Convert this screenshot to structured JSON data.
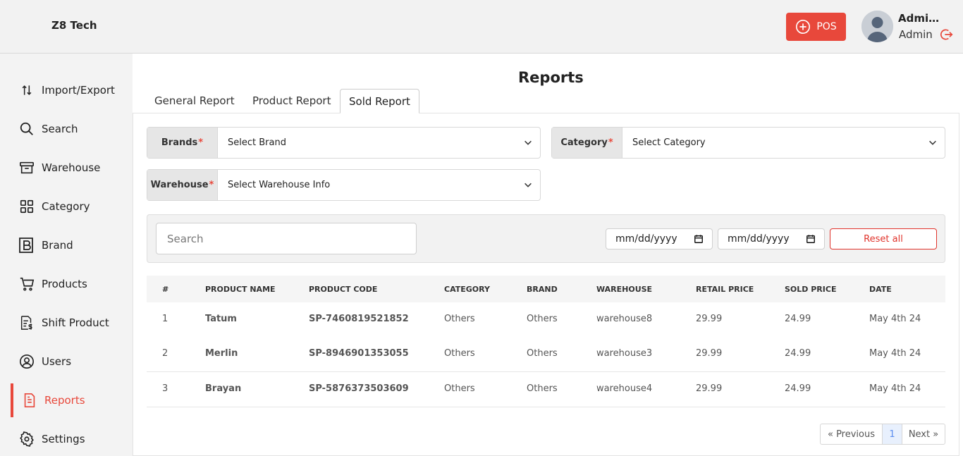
{
  "header": {
    "brand": "Z8 Tech",
    "pos_label": "POS",
    "user_name": "Admin...",
    "user_role": "Admin"
  },
  "sidebar": {
    "items": [
      {
        "label": "Import/Export",
        "icon": "import-export-icon"
      },
      {
        "label": "Search",
        "icon": "search-icon"
      },
      {
        "label": "Warehouse",
        "icon": "warehouse-icon"
      },
      {
        "label": "Category",
        "icon": "category-grid-icon"
      },
      {
        "label": "Brand",
        "icon": "brand-icon"
      },
      {
        "label": "Products",
        "icon": "cart-icon"
      },
      {
        "label": "Shift Product",
        "icon": "shift-product-icon"
      },
      {
        "label": "Users",
        "icon": "user-circle-icon"
      },
      {
        "label": "Reports",
        "icon": "report-icon",
        "active": true
      },
      {
        "label": "Settings",
        "icon": "gear-icon"
      }
    ]
  },
  "page": {
    "title": "Reports",
    "tabs": [
      "General Report",
      "Product Report",
      "Sold Report"
    ],
    "active_tab": "Sold Report"
  },
  "filters": {
    "brands": {
      "label": "Brands",
      "value": "Select Brand"
    },
    "category": {
      "label": "Category",
      "value": "Select Category"
    },
    "warehouse": {
      "label": "Warehouse",
      "value": "Select Warehouse Info"
    },
    "required_mark": "*",
    "search_placeholder": "Search",
    "date_from": "mm/dd/yyyy",
    "date_to": "mm/dd/yyyy",
    "reset_label": "Reset all"
  },
  "table": {
    "headers": [
      "#",
      "PRODUCT NAME",
      "PRODUCT CODE",
      "CATEGORY",
      "BRAND",
      "WAREHOUSE",
      "RETAIL PRICE",
      "SOLD PRICE",
      "DATE"
    ],
    "rows": [
      [
        "1",
        "Tatum",
        "SP-7460819521852",
        "Others",
        "Others",
        "warehouse8",
        "29.99",
        "24.99",
        "May 4th 24"
      ],
      [
        "2",
        "Merlin",
        "SP-8946901353055",
        "Others",
        "Others",
        "warehouse3",
        "29.99",
        "24.99",
        "May 4th 24"
      ],
      [
        "3",
        "Brayan",
        "SP-5876373503609",
        "Others",
        "Others",
        "warehouse4",
        "29.99",
        "24.99",
        "May 4th 24"
      ]
    ]
  },
  "pagination": {
    "prev": "« Previous",
    "current": "1",
    "next": "Next »"
  },
  "colors": {
    "accent": "#e8483b",
    "sidebar_bg": "#f3f3f3",
    "header_bg": "#f2f2f2"
  }
}
